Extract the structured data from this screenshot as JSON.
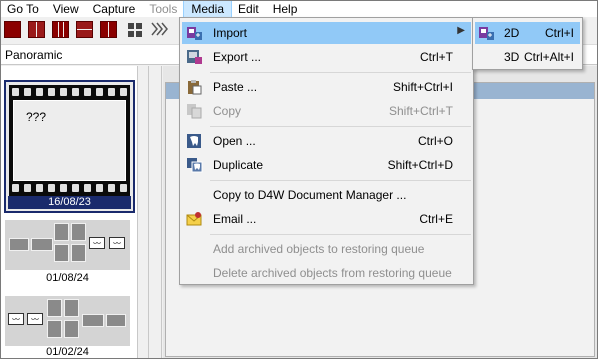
{
  "menubar": {
    "items": [
      {
        "label": "Go To",
        "state": "normal"
      },
      {
        "label": "View",
        "state": "normal"
      },
      {
        "label": "Capture",
        "state": "normal"
      },
      {
        "label": "Tools",
        "state": "disabled"
      },
      {
        "label": "Media",
        "state": "active"
      },
      {
        "label": "Edit",
        "state": "normal"
      },
      {
        "label": "Help",
        "state": "normal"
      }
    ]
  },
  "panobar": {
    "label": "Panoramic"
  },
  "thumbnails": [
    {
      "text": "???",
      "date": "16/08/23",
      "selected": true
    },
    {
      "date": "01/08/24"
    },
    {
      "date": "01/02/24"
    }
  ],
  "media_menu": {
    "items": [
      {
        "label": "Import",
        "shortcut": "",
        "icon": "import-icon",
        "enabled": true,
        "highlighted": true,
        "submenu": true
      },
      {
        "label": "Export ...",
        "shortcut": "Ctrl+T",
        "icon": "export-icon",
        "enabled": true
      },
      {
        "label": "Paste ...",
        "shortcut": "Shift+Ctrl+I",
        "icon": "paste-icon",
        "enabled": true
      },
      {
        "label": "Copy",
        "shortcut": "Shift+Ctrl+T",
        "icon": "copy-icon",
        "enabled": false
      },
      {
        "label": "Open ...",
        "shortcut": "Ctrl+O",
        "icon": "open-tooth-icon",
        "enabled": true
      },
      {
        "label": "Duplicate",
        "shortcut": "Shift+Ctrl+D",
        "icon": "duplicate-icon",
        "enabled": true
      },
      {
        "label": "Copy to D4W Document Manager ...",
        "shortcut": "",
        "icon": "",
        "enabled": true
      },
      {
        "label": "Email ...",
        "shortcut": "Ctrl+E",
        "icon": "email-icon",
        "enabled": true
      },
      {
        "label": "Add archived objects to restoring queue",
        "shortcut": "",
        "icon": "",
        "enabled": false
      },
      {
        "label": "Delete archived objects from restoring queue",
        "shortcut": "",
        "icon": "",
        "enabled": false
      }
    ]
  },
  "import_submenu": {
    "items": [
      {
        "label": "2D",
        "shortcut": "Ctrl+I",
        "icon": "import-2d-icon",
        "highlighted": true
      },
      {
        "label": "3D",
        "shortcut": "Ctrl+Alt+I",
        "icon": "",
        "highlighted": false
      }
    ]
  },
  "colors": {
    "highlight": "#91c9f7",
    "selection_navy": "#1a2a6c",
    "toolbar_red": "#8b0000",
    "disabled_text": "#8f8f8f"
  }
}
